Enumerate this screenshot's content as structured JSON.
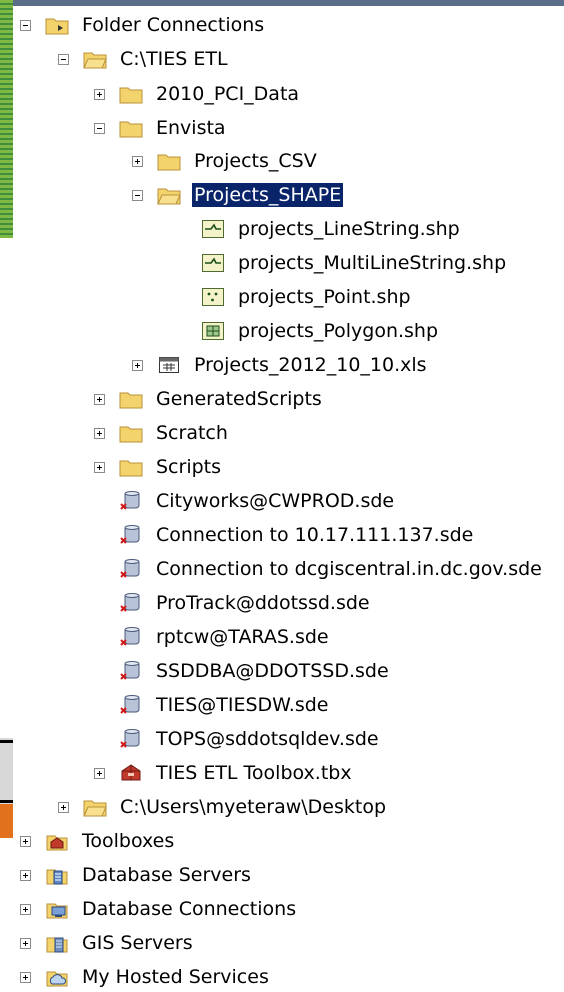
{
  "tree": {
    "folder_connections": "Folder Connections",
    "ties_etl": "C:\\TIES ETL",
    "pci_data": "2010_PCI_Data",
    "envista": "Envista",
    "projects_csv": "Projects_CSV",
    "projects_shape": "Projects_SHAPE",
    "shp_linestring": "projects_LineString.shp",
    "shp_multilinestring": "projects_MultiLineString.shp",
    "shp_point": "projects_Point.shp",
    "shp_polygon": "projects_Polygon.shp",
    "xls": "Projects_2012_10_10.xls",
    "generated_scripts": "GeneratedScripts",
    "scratch": "Scratch",
    "scripts": "Scripts",
    "sde_cityworks": "Cityworks@CWPROD.sde",
    "sde_conn_ip": "Connection to 10.17.111.137.sde",
    "sde_conn_dc": "Connection to dcgiscentral.in.dc.gov.sde",
    "sde_protrack": "ProTrack@ddotssd.sde",
    "sde_rptcw": "rptcw@TARAS.sde",
    "sde_ssddba": "SSDDBA@DDOTSSD.sde",
    "sde_ties": "TIES@TIESDW.sde",
    "sde_tops": "TOPS@sddotsqldev.sde",
    "toolbox_tbx": "TIES ETL Toolbox.tbx",
    "desktop": "C:\\Users\\myeteraw\\Desktop",
    "toolboxes": "Toolboxes",
    "database_servers": "Database Servers",
    "database_connections": "Database Connections",
    "gis_servers": "GIS Servers",
    "my_hosted_services": "My Hosted Services"
  },
  "colors": {
    "selection": "#0a246a",
    "folder": "#f3d36b"
  }
}
